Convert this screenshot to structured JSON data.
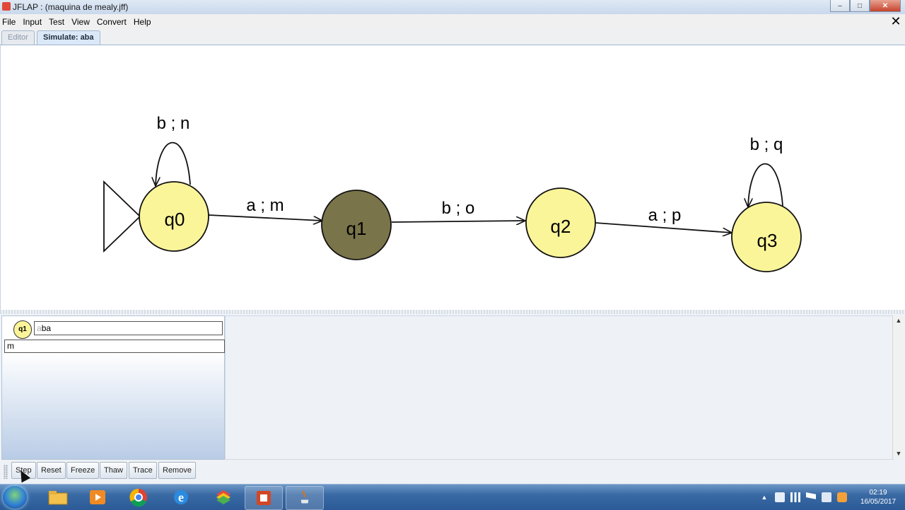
{
  "window": {
    "title": "JFLAP : (maquina de mealy.jff)",
    "close_label": "✕",
    "minimize_label": "–",
    "maximize_label": "□"
  },
  "menu": {
    "items": [
      "File",
      "Input",
      "Test",
      "View",
      "Convert",
      "Help"
    ],
    "close_label": "✕"
  },
  "tabs": {
    "editor": "Editor",
    "simulate": "Simulate: aba"
  },
  "automaton": {
    "states": [
      {
        "id": "q0",
        "label": "q0",
        "initial": true,
        "current": false
      },
      {
        "id": "q1",
        "label": "q1",
        "initial": false,
        "current": true
      },
      {
        "id": "q2",
        "label": "q2",
        "initial": false,
        "current": false
      },
      {
        "id": "q3",
        "label": "q3",
        "initial": false,
        "current": false
      }
    ],
    "transitions": [
      {
        "from": "q0",
        "to": "q0",
        "label": "b ; n"
      },
      {
        "from": "q0",
        "to": "q1",
        "label": "a ; m"
      },
      {
        "from": "q1",
        "to": "q2",
        "label": "b ; o"
      },
      {
        "from": "q2",
        "to": "q3",
        "label": "a ; p"
      },
      {
        "from": "q3",
        "to": "q3",
        "label": "b ; q"
      }
    ],
    "colors": {
      "state_fill": "#fbf59a",
      "current_fill": "#7a744a",
      "stroke": "#111111"
    }
  },
  "simulation": {
    "current_state": "q1",
    "input_tape_read": "a",
    "input_tape_remaining": "ba",
    "output": "m"
  },
  "buttons": {
    "step": "Step",
    "reset": "Reset",
    "freeze": "Freeze",
    "thaw": "Thaw",
    "trace": "Trace",
    "remove": "Remove"
  },
  "taskbar": {
    "apps": [
      "file-explorer-icon",
      "media-player-icon",
      "chrome-icon",
      "internet-explorer-icon",
      "bluestacks-icon",
      "powerpoint-icon",
      "java-icon"
    ],
    "time": "02:19",
    "date": "16/05/2017"
  }
}
